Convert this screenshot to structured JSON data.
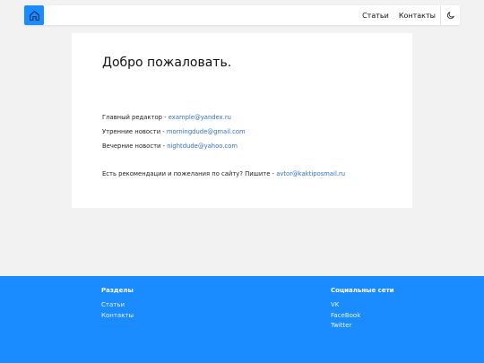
{
  "navbar": {
    "links": [
      "Статьи",
      "Контакты"
    ]
  },
  "main": {
    "title": "Добро пожаловать.",
    "contacts": [
      {
        "label": "Главный редактор - ",
        "email": "example@yandex.ru"
      },
      {
        "label": "Утренние новости - ",
        "email": "morningdude@gmail.com"
      },
      {
        "label": "Вечерние новости - ",
        "email": "nightdude@yahoo.com"
      }
    ],
    "feedback": {
      "label": "Есть рекомендации и пожелания по сайту? Пишите - ",
      "email": "avtor@kaktiposmail.ru"
    }
  },
  "footer": {
    "sections": {
      "heading": "Разделы",
      "links": [
        "Статьи",
        "Контакты"
      ]
    },
    "social": {
      "heading": "Социальные сети",
      "links": [
        "VK",
        "FaceBook",
        "Twitter"
      ]
    }
  },
  "colors": {
    "accent": "#1a8cff",
    "link": "#2f6fd6",
    "background": "#f2f2f2"
  },
  "icons": {
    "home": "home-icon",
    "theme": "moon-icon"
  }
}
